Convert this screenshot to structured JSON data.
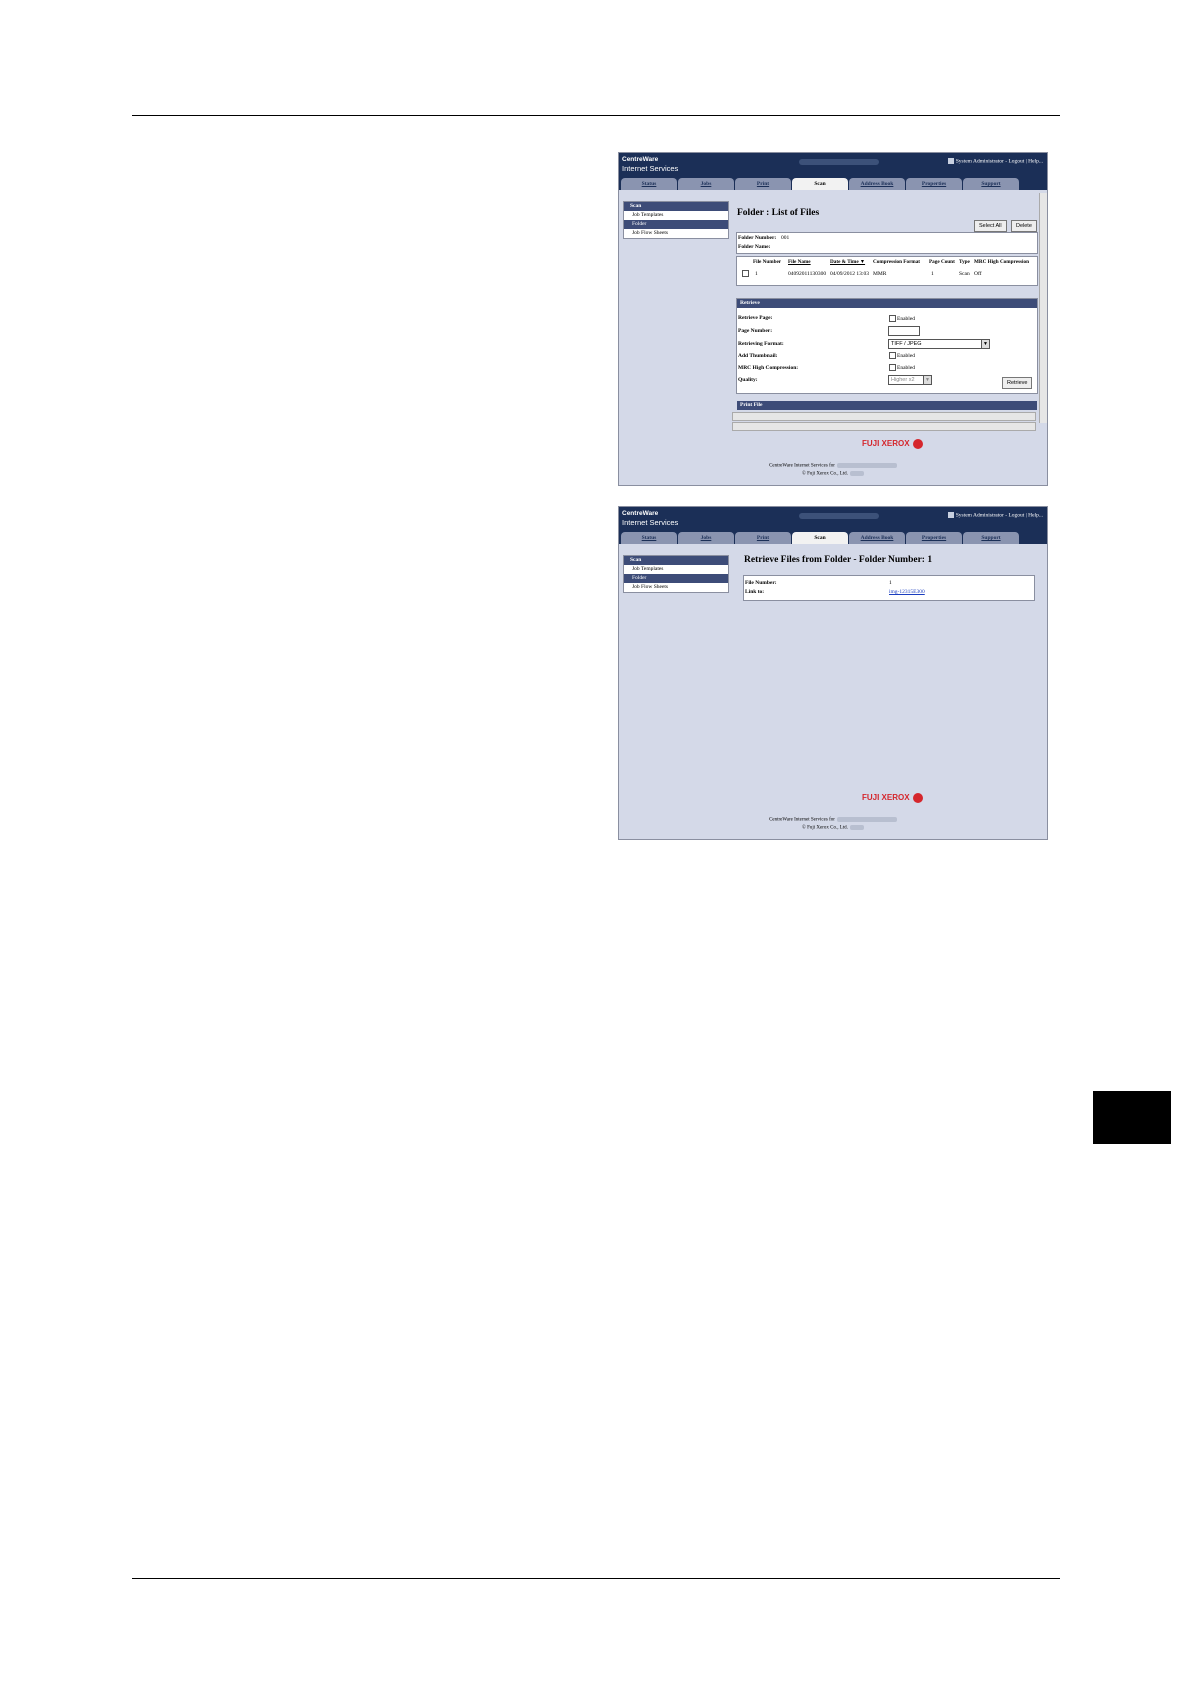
{
  "brand": {
    "line1": "CentreWare",
    "line2": "Internet Services"
  },
  "admin_text": "System Administrator - Logout | Help...",
  "tabs": [
    "Status",
    "Jobs",
    "Print",
    "Scan",
    "Address Book",
    "Properties",
    "Support"
  ],
  "active_tab": "Scan",
  "sidebar": {
    "header": "Scan",
    "items": [
      "Job Templates",
      "Folder",
      "Job Flow Sheets"
    ],
    "selected": "Folder"
  },
  "shot1": {
    "title": "Folder : List of Files",
    "select_all": "Select All",
    "delete": "Delete",
    "folder_number_label": "Folder Number:",
    "folder_number_value": "001",
    "folder_name_label": "Folder Name:",
    "columns": [
      "File Number",
      "File Name",
      "Date & Time ▼",
      "Compression Format",
      "Page Count",
      "Type",
      "MRC High Compression"
    ],
    "row": [
      "1",
      "04092011130300",
      "04/09/2012 13:03",
      "MMR",
      "1",
      "Scan",
      "Off"
    ],
    "retrieve": {
      "header": "Retrieve",
      "retrieve_page_label": "Retrieve Page:",
      "page_number_label": "Page Number:",
      "format_label": "Retrieving Format:",
      "thumbnail_label": "Add Thumbnail:",
      "mrc_label": "MRC High Compression:",
      "quality_label": "Quality:",
      "enabled": "Enabled",
      "format_value": "TIFF / JPEG",
      "quality_value": "Higher x2",
      "retrieve_button": "Retrieve"
    },
    "print_header": "Print File"
  },
  "shot2": {
    "title": "Retrieve Files from Folder - Folder Number: 1",
    "file_number_label": "File Number:",
    "file_number_value": "1",
    "link_label": "Link to:",
    "link_value": "img-12315E300"
  },
  "logo": "FUJI XEROX",
  "footer": {
    "line1": "CentreWare Internet Services for",
    "line2": "© Fuji Xerox Co., Ltd."
  }
}
